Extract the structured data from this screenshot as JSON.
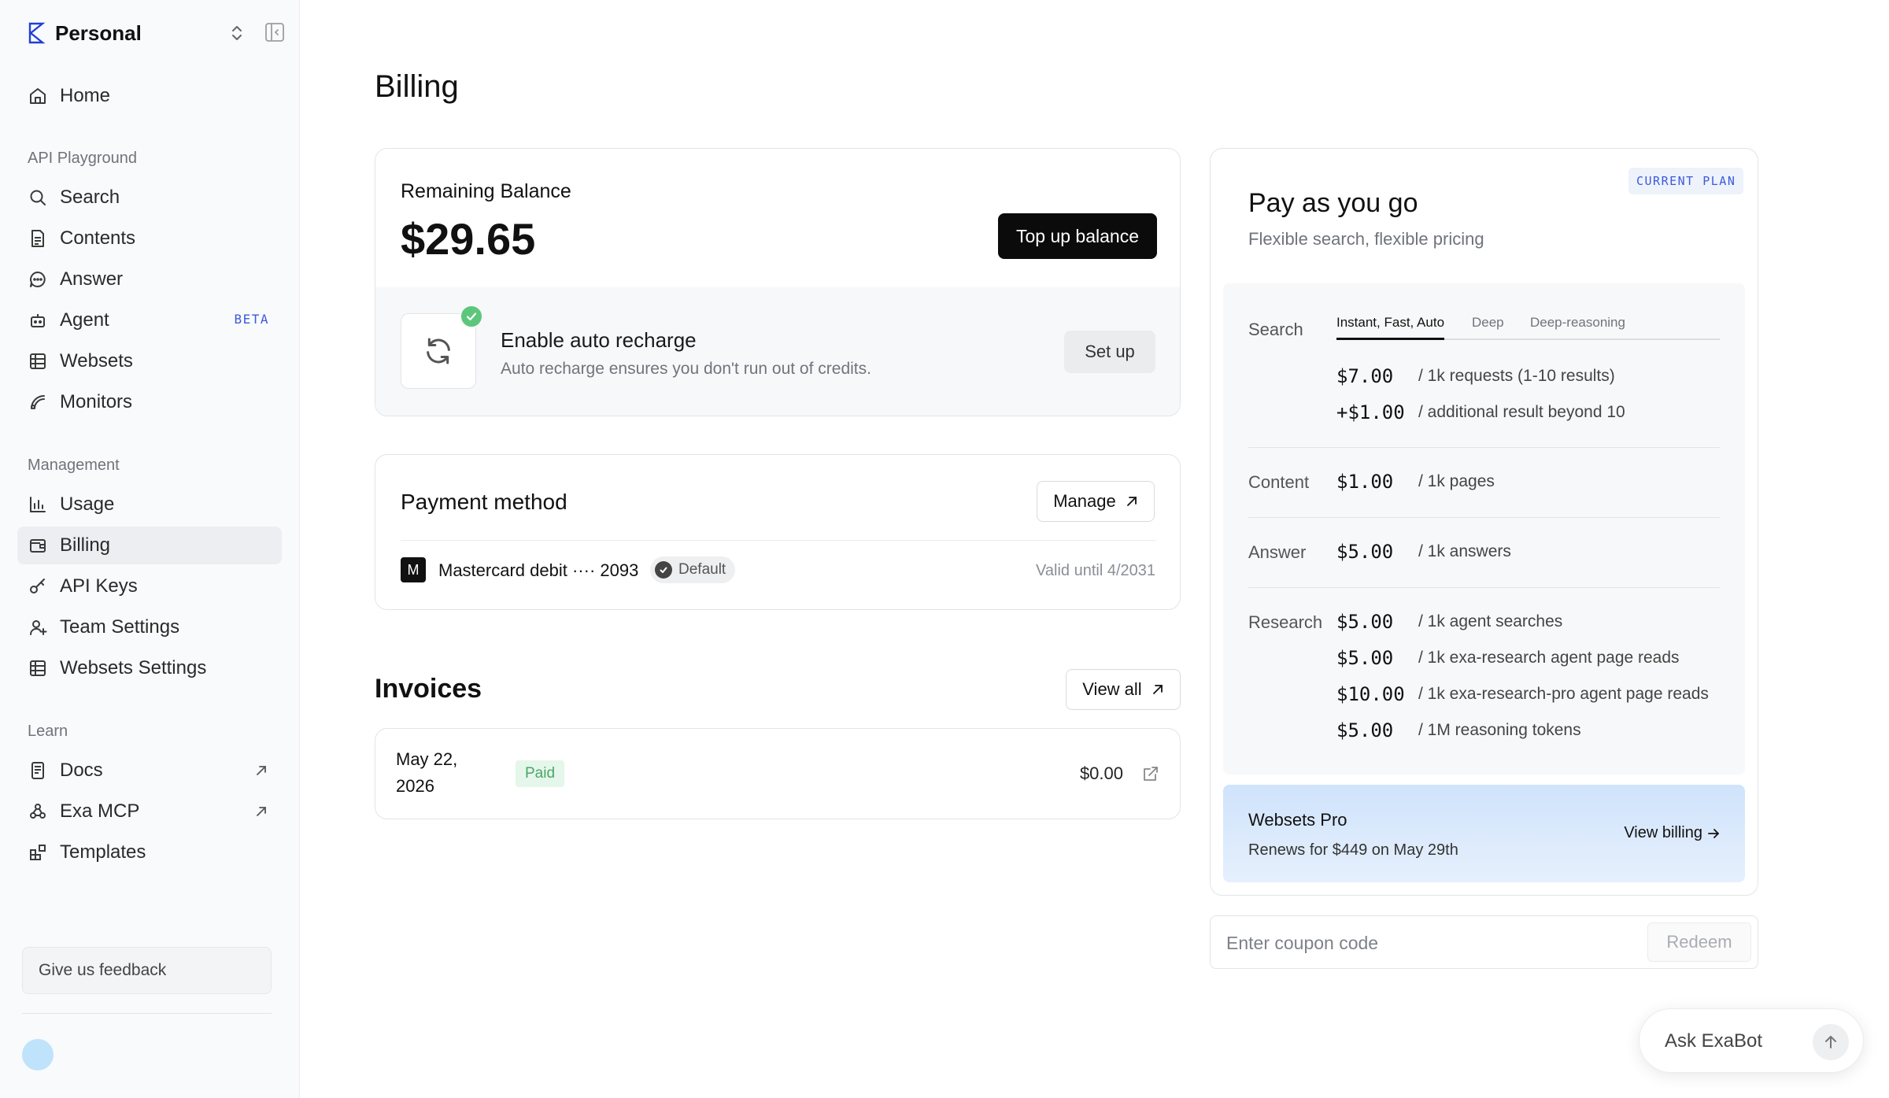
{
  "workspace": {
    "name": "Personal"
  },
  "nav": {
    "home": "Home",
    "api_playground_label": "API Playground",
    "search": "Search",
    "contents": "Contents",
    "answer": "Answer",
    "agent": "Agent",
    "agent_badge": "BETA",
    "websets": "Websets",
    "monitors": "Monitors",
    "management_label": "Management",
    "usage": "Usage",
    "billing": "Billing",
    "api_keys": "API Keys",
    "team_settings": "Team Settings",
    "websets_settings": "Websets Settings",
    "learn_label": "Learn",
    "docs": "Docs",
    "exa_mcp": "Exa MCP",
    "templates": "Templates",
    "feedback": "Give us feedback",
    "active_item": "billing"
  },
  "page": {
    "title": "Billing"
  },
  "balance": {
    "label": "Remaining Balance",
    "amount": "$29.65",
    "top_up_label": "Top up balance",
    "auto_recharge_title": "Enable auto recharge",
    "auto_recharge_desc": "Auto recharge ensures you don't run out of credits.",
    "setup_label": "Set up"
  },
  "payment": {
    "title": "Payment method",
    "manage_label": "Manage",
    "card_brand_letter": "M",
    "card_text": "Mastercard debit ···· 2093",
    "default_label": "Default",
    "valid_until": "Valid until 4/2031"
  },
  "invoices": {
    "title": "Invoices",
    "view_all_label": "View all",
    "rows": [
      {
        "date": "May 22, 2026",
        "status": "Paid",
        "amount": "$0.00"
      }
    ]
  },
  "plan": {
    "badge": "CURRENT PLAN",
    "title": "Pay as you go",
    "subtitle": "Flexible search, flexible pricing",
    "search_label": "Search",
    "tabs": [
      "Instant, Fast, Auto",
      "Deep",
      "Deep-reasoning"
    ],
    "active_tab": 0,
    "search_prices": [
      {
        "price": "$7.00",
        "desc": "/ 1k requests (1-10 results)"
      },
      {
        "price": "+$1.00",
        "desc": "/ additional result beyond 10"
      }
    ],
    "content_label": "Content",
    "content_price": {
      "price": "$1.00",
      "desc": "/ 1k pages"
    },
    "answer_label": "Answer",
    "answer_price": {
      "price": "$5.00",
      "desc": "/ 1k answers"
    },
    "research_label": "Research",
    "research_prices": [
      {
        "price": "$5.00",
        "desc": "/ 1k agent searches"
      },
      {
        "price": "$5.00",
        "desc": "/ 1k exa-research agent page reads"
      },
      {
        "price": "$10.00",
        "desc": "/ 1k exa-research-pro agent page reads"
      },
      {
        "price": "$5.00",
        "desc": "/ 1M reasoning tokens"
      }
    ],
    "websets_pro": {
      "title": "Websets Pro",
      "subtitle": "Renews for $449 on May 29th",
      "link_label": "View billing"
    }
  },
  "coupon": {
    "placeholder": "Enter coupon code",
    "redeem_label": "Redeem"
  },
  "askbot": {
    "label": "Ask ExaBot"
  },
  "colors": {
    "accent": "#1f40d6",
    "beta": "#3b5bdb",
    "paid_bg": "#e5f6ea",
    "paid_text": "#4aa668",
    "success": "#5cc77a"
  }
}
